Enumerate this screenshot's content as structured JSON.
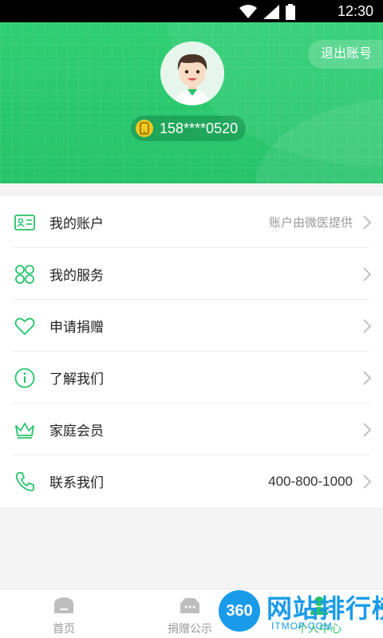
{
  "status_bar": {
    "time": "12:30",
    "icons": [
      "wifi-icon",
      "signal-icon",
      "battery-icon"
    ]
  },
  "header": {
    "logout_label": "退出账号",
    "phone": "158****0520",
    "accent_color": "#27c36a"
  },
  "menu": {
    "items": [
      {
        "icon": "id-card-icon",
        "label": "我的账户",
        "value": "账户由微医提供"
      },
      {
        "icon": "apps-icon",
        "label": "我的服务",
        "value": ""
      },
      {
        "icon": "heart-icon",
        "label": "申请捐赠",
        "value": ""
      },
      {
        "icon": "info-icon",
        "label": "了解我们",
        "value": ""
      },
      {
        "icon": "crown-icon",
        "label": "家庭会员",
        "value": ""
      },
      {
        "icon": "phone-icon",
        "label": "联系我们",
        "value": "400-800-1000"
      }
    ]
  },
  "tabbar": {
    "tabs": [
      {
        "icon": "home-icon",
        "label": "首页"
      },
      {
        "icon": "donation-box-icon",
        "label": "捐赠公示"
      },
      {
        "icon": "user-icon",
        "label": "个人中心"
      }
    ]
  },
  "watermark": {
    "badge": "360",
    "title": "网站排行榜",
    "sub": "ITMOP.COM"
  }
}
